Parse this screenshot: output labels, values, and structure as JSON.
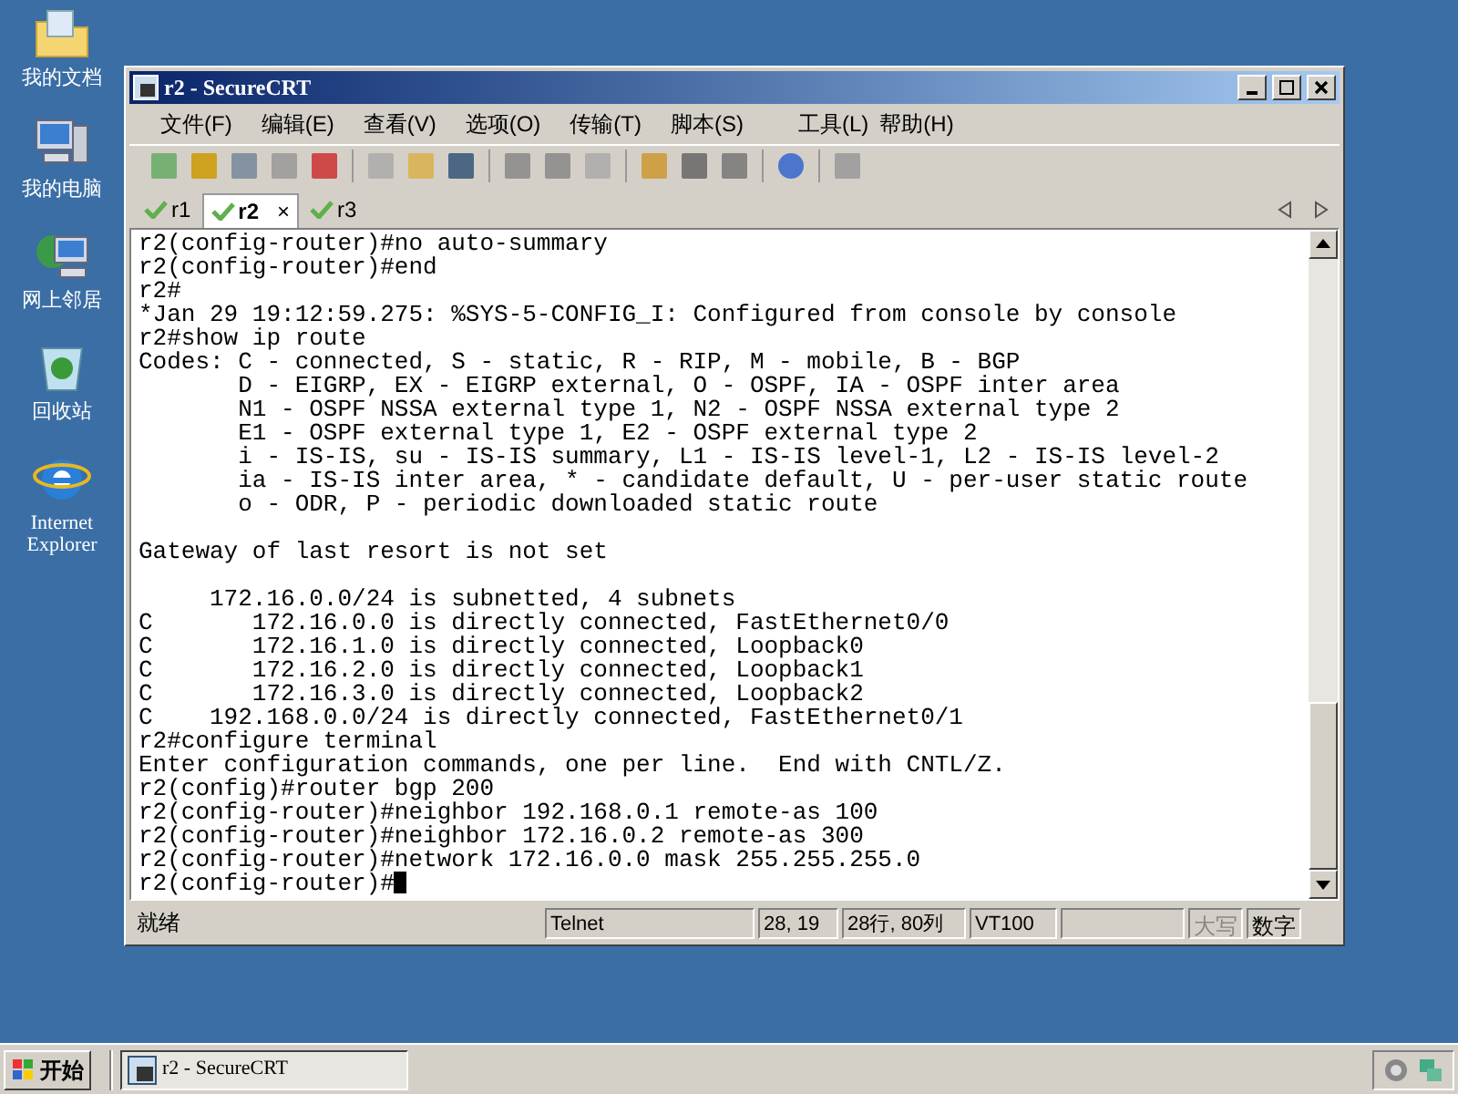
{
  "desktop_icons": [
    {
      "kind": "documents",
      "label": "我的文档"
    },
    {
      "kind": "computer",
      "label": "我的电脑"
    },
    {
      "kind": "network",
      "label": "网上邻居"
    },
    {
      "kind": "recycle",
      "label": "回收站"
    },
    {
      "kind": "browser",
      "label": "Internet Explorer"
    }
  ],
  "window": {
    "title": "r2 - SecureCRT",
    "menu": [
      "文件(F)",
      "编辑(E)",
      "查看(V)",
      "选项(O)",
      "传输(T)",
      "脚本(S)",
      "工具(L)",
      "帮助(H)"
    ],
    "tabs": [
      {
        "label": "r1",
        "selected": false,
        "connected": true
      },
      {
        "label": "r2",
        "selected": true,
        "connected": true
      },
      {
        "label": "r3",
        "selected": false,
        "connected": true
      }
    ],
    "tab_close": "×",
    "terminal": {
      "blocks": [
        [
          "r2(config-router)#no auto-summary",
          "r2(config-router)#end",
          "r2#",
          "*Jan 29 19:12:59.275: %SYS-5-CONFIG_I: Configured from console by console",
          "r2#show ip route",
          "Codes: C - connected, S - static, R - RIP, M - mobile, B - BGP",
          "       D - EIGRP, EX - EIGRP external, O - OSPF, IA - OSPF inter area",
          "       N1 - OSPF NSSA external type 1, N2 - OSPF NSSA external type 2",
          "       E1 - OSPF external type 1, E2 - OSPF external type 2",
          "       i - IS-IS, su - IS-IS summary, L1 - IS-IS level-1, L2 - IS-IS level-2",
          "       ia - IS-IS inter area, * - candidate default, U - per-user static route",
          "       o - ODR, P - periodic downloaded static route"
        ],
        [
          "Gateway of last resort is not set"
        ],
        [
          "     172.16.0.0/24 is subnetted, 4 subnets",
          "C       172.16.0.0 is directly connected, FastEthernet0/0",
          "C       172.16.1.0 is directly connected, Loopback0",
          "C       172.16.2.0 is directly connected, Loopback1",
          "C       172.16.3.0 is directly connected, Loopback2",
          "C    192.168.0.0/24 is directly connected, FastEthernet0/1",
          "r2#configure terminal",
          "Enter configuration commands, one per line.  End with CNTL/Z.",
          "r2(config)#router bgp 200",
          "r2(config-router)#neighbor 192.168.0.1 remote-as 100",
          "r2(config-router)#neighbor 172.16.0.2 remote-as 300",
          "r2(config-router)#network 172.16.0.0 mask 255.255.255.0",
          "r2(config-router)#"
        ]
      ],
      "cursor": true
    },
    "status_bar": [
      {
        "text": "就绪",
        "kind": "message",
        "active": true
      },
      {
        "text": "Telnet",
        "kind": "field",
        "active": true
      },
      {
        "text": "28, 19",
        "kind": "field",
        "active": true
      },
      {
        "text": "28行, 80列",
        "kind": "field",
        "active": true
      },
      {
        "text": "VT100",
        "kind": "field",
        "active": true
      },
      {
        "kind": "field"
      },
      {
        "text": "大写",
        "kind": "indicator",
        "active": false
      },
      {
        "text": "数字",
        "kind": "indicator",
        "active": true
      }
    ]
  },
  "taskbar": {
    "start": "开始",
    "tasks": [
      {
        "label": "r2 - SecureCRT",
        "selected": true
      }
    ]
  }
}
